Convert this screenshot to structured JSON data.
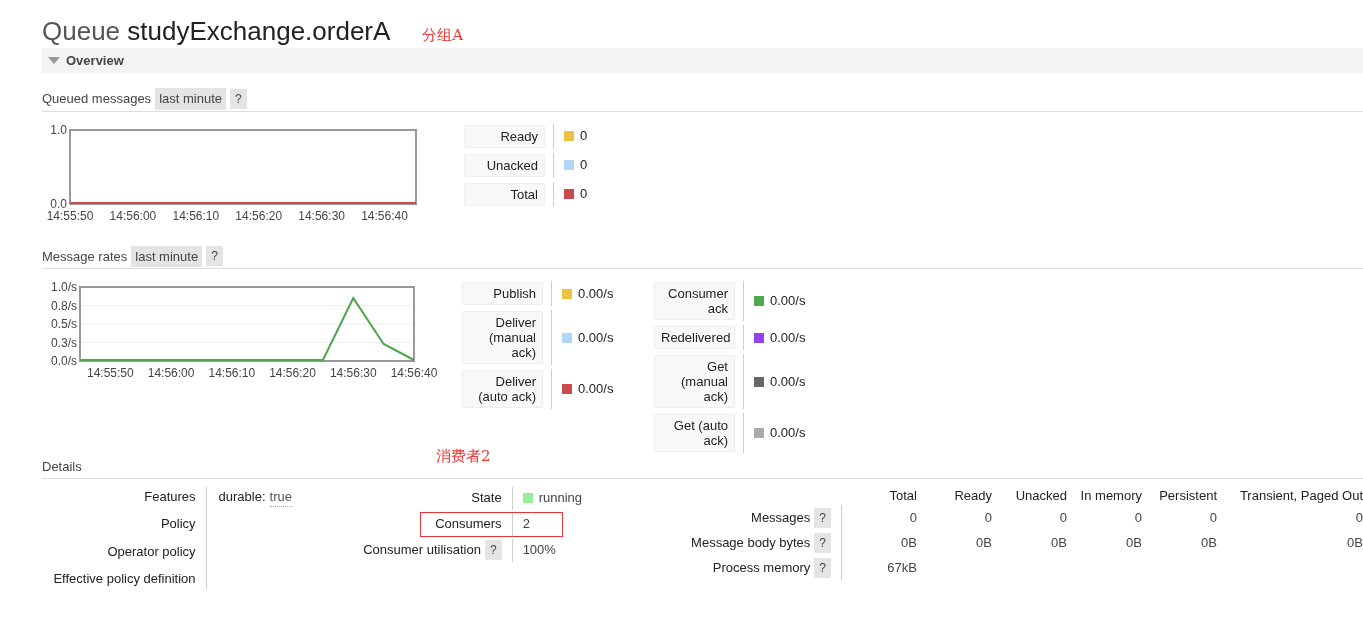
{
  "title": {
    "prefix": "Queue",
    "name": "studyExchange.orderA",
    "annotation": "分组A"
  },
  "section": {
    "label": "Overview",
    "expanded": true
  },
  "queued_messages": {
    "label": "Queued messages",
    "range": "last minute",
    "help": "?",
    "chart_data": {
      "type": "line",
      "categories": [
        "14:55:50",
        null,
        "14:56:00",
        null,
        "14:56:10",
        null,
        "14:56:20",
        null,
        "14:56:30",
        null,
        "14:56:40",
        null
      ],
      "ylim": [
        0,
        1
      ],
      "yticks": [
        {
          "value": 1,
          "label": "1.0"
        },
        {
          "value": 0,
          "label": "0.0"
        }
      ],
      "series": [
        {
          "color": "#cb4b4b",
          "values": [
            0,
            0,
            0,
            0,
            0,
            0,
            0,
            0,
            0,
            0,
            0,
            0
          ]
        }
      ]
    },
    "legend_columns": [
      [
        {
          "label": "Ready",
          "value": "0",
          "color": "#edc240"
        },
        {
          "label": "Unacked",
          "value": "0",
          "color": "#afd8f8"
        },
        {
          "label": "Total",
          "value": "0",
          "color": "#cb4b4b"
        }
      ]
    ]
  },
  "message_rates": {
    "label": "Message rates",
    "range": "last minute",
    "help": "?",
    "chart_data": {
      "type": "line",
      "grid": true,
      "categories": [
        null,
        "14:55:50",
        null,
        "14:56:00",
        null,
        "14:56:10",
        null,
        "14:56:20",
        null,
        "14:56:30",
        null,
        "14:56:40"
      ],
      "ylim": [
        0,
        1
      ],
      "yticks": [
        {
          "value": 1,
          "label": "1.0/s"
        },
        {
          "value": 0.75,
          "label": "0.8/s"
        },
        {
          "value": 0.5,
          "label": "0.5/s"
        },
        {
          "value": 0.25,
          "label": "0.3/s"
        },
        {
          "value": 0,
          "label": "0.0/s"
        }
      ],
      "series": [
        {
          "color": "#4da74d",
          "values": [
            0,
            0,
            0,
            0,
            0,
            0,
            0,
            0,
            0,
            0.85,
            0.23,
            0
          ]
        }
      ]
    },
    "legend_columns": [
      [
        {
          "label": "Publish",
          "value": "0.00/s",
          "color": "#edc240"
        },
        {
          "label": "Deliver\n(manual\nack)",
          "value": "0.00/s",
          "color": "#afd8f8"
        },
        {
          "label": "Deliver\n(auto ack)",
          "value": "0.00/s",
          "color": "#cb4b4b"
        }
      ],
      [
        {
          "label": "Consumer\nack",
          "value": "0.00/s",
          "color": "#4da74d"
        },
        {
          "label": "Redelivered",
          "value": "0.00/s",
          "color": "#9440ed"
        },
        {
          "label": "Get\n(manual\nack)",
          "value": "0.00/s",
          "color": "#666666"
        },
        {
          "label": "Get (auto\nack)",
          "value": "0.00/s",
          "color": "#aaaaaa"
        }
      ]
    ]
  },
  "details": {
    "label": "Details",
    "annotation": "消费者2",
    "properties": [
      {
        "label": "Features",
        "key": "durable:",
        "value": "true"
      },
      {
        "label": "Policy"
      },
      {
        "label": "Operator policy"
      },
      {
        "label": "Effective policy definition"
      }
    ],
    "status": [
      {
        "label": "State",
        "value": "running",
        "color": "#99ee99"
      },
      {
        "label": "Consumers",
        "value": "2",
        "highlighted": true
      },
      {
        "label": "Consumer utilisation",
        "help": "?",
        "value": "100%"
      }
    ],
    "stats": {
      "columns": [
        "Total",
        "Ready",
        "Unacked",
        "In memory",
        "Persistent",
        "Transient, Paged Out"
      ],
      "rows": [
        {
          "label": "Messages",
          "help": "?",
          "cells": [
            "0",
            "0",
            "0",
            "0",
            "0",
            "0"
          ]
        },
        {
          "label": "Message body bytes",
          "help": "?",
          "cells": [
            "0B",
            "0B",
            "0B",
            "0B",
            "0B",
            "0B"
          ]
        },
        {
          "label": "Process memory",
          "help": "?",
          "cells": [
            "67kB"
          ]
        }
      ]
    }
  }
}
